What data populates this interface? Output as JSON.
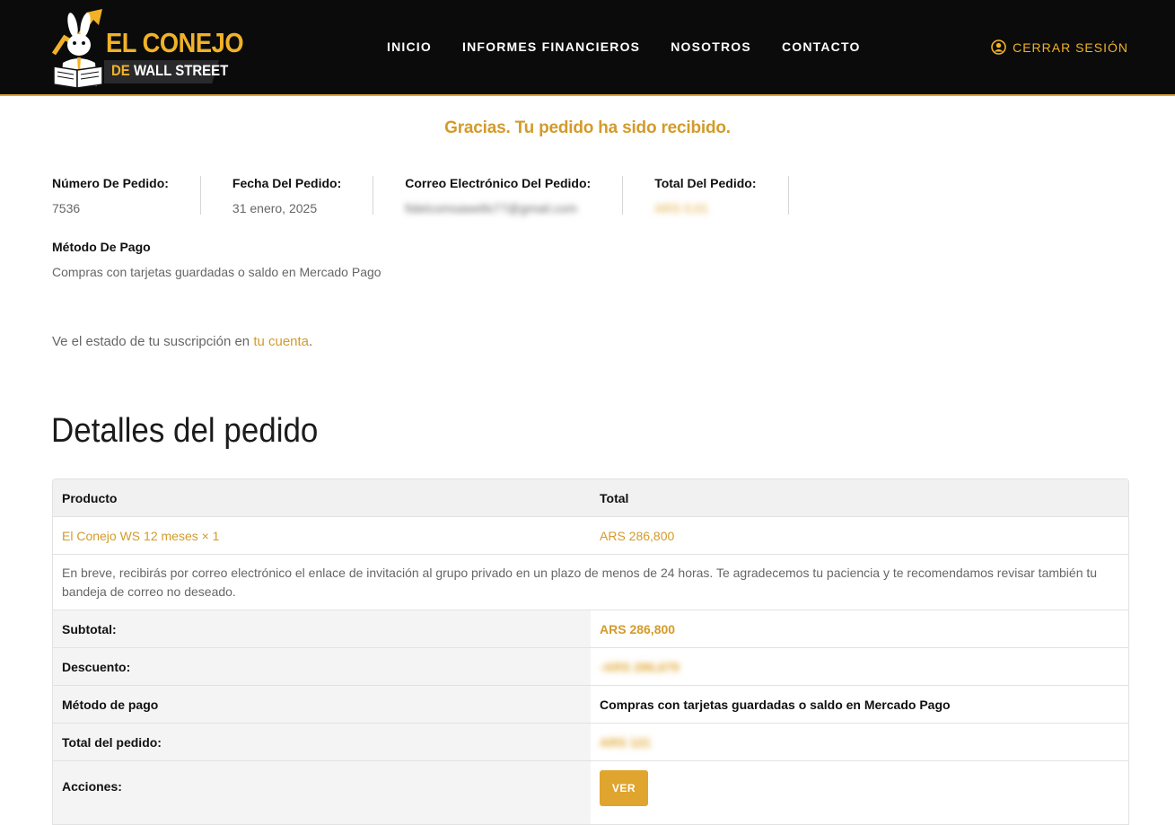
{
  "brand": {
    "line1": "EL CONEJO",
    "line2_prefix": "DE",
    "line2_main": "WALL STREET",
    "accent_color": "#f1b227",
    "logo_icon": "rabbit-reading-newspaper-icon"
  },
  "nav": {
    "items": [
      "INICIO",
      "INFORMES FINANCIEROS",
      "NOSOTROS",
      "CONTACTO"
    ],
    "logout_label": "CERRAR SESIÓN",
    "logout_icon": "user-circle-icon"
  },
  "thanks_message": "Gracias. Tu pedido ha sido recibido.",
  "overview": {
    "order_number_label": "Número De Pedido:",
    "order_number": "7536",
    "date_label": "Fecha Del Pedido:",
    "date": "31 enero, 2025",
    "email_label": "Correo Electrónico Del Pedido:",
    "email": "fidelcomsawells77@gmail.com",
    "total_label": "Total Del Pedido:",
    "total": "ARS 0,01",
    "payment_label": "Método De Pago",
    "payment": "Compras con tarjetas guardadas o saldo en Mercado Pago"
  },
  "status": {
    "text_before": "Ve el estado de tu suscripción en ",
    "link": "tu cuenta",
    "text_after": "."
  },
  "details": {
    "title": "Detalles del pedido",
    "col_product": "Producto",
    "col_total": "Total",
    "item_name": "El Conejo WS 12 meses × 1",
    "item_total": "ARS 286,800",
    "note": "En breve, recibirás por correo electrónico el enlace de invitación al grupo privado en un plazo de menos de 24 horas. Te agradecemos tu paciencia y te recomendamos revisar también tu bandeja de correo no deseado.",
    "subtotal_label": "Subtotal:",
    "subtotal": "ARS 286,800",
    "discount_label": "Descuento:",
    "discount": "-ARS 286,679",
    "method_label": "Método de pago",
    "method": "Compras con tarjetas guardadas o saldo en Mercado Pago",
    "total_label": "Total del pedido:",
    "total": "ARS 121",
    "actions_label": "Acciones:",
    "view_button": "VER"
  }
}
